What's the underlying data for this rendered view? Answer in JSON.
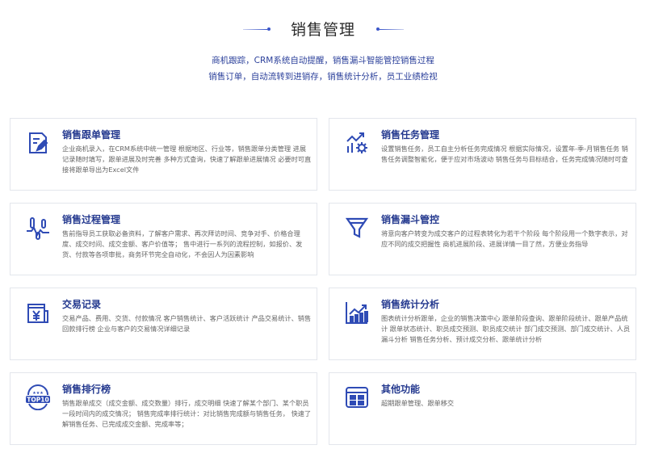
{
  "header": {
    "title": "销售管理",
    "subtitle_line1": "商机跟踪，CRM系统自动提醒，销售漏斗智能管控销售过程",
    "subtitle_line2": "销售订单，自动流转到进销存，销售统计分析，员工业绩检视"
  },
  "cards": [
    {
      "title": "销售跟单管理",
      "icon": "document-edit-icon",
      "desc": "企业商机录入，在CRM系统中统一管理 根据地区、行业等，销售跟单分类管理 进展记录随时填写，跟单进展及时完善 多种方式查询，快速了解跟单进展情况 必要时可直接将跟单导出为Excel文件"
    },
    {
      "title": "销售任务管理",
      "icon": "chart-gear-icon",
      "desc": "设置销售任务，员工自主分析任务完成情况 根据实际情况，设置年-季-月销售任务 销售任务调整智能化，便于应对市场波动 销售任务与目标结合，任务完成情况随时可查"
    },
    {
      "title": "销售过程管理",
      "icon": "process-pulse-icon",
      "desc": "售前指导员工获取必备资料，了解客户需求、再次拜访时间、竞争对手、价格合理度、成交时间、成交金额、客户价值等； 售中进行一系列的流程控制，如报价、发货、付款等各项审批，商务环节完全自动化，不会因人为因素影响"
    },
    {
      "title": "销售漏斗管控",
      "icon": "funnel-icon",
      "desc": "将意向客户转变为成交客户的过程表转化为若干个阶段 每个阶段用一个数字表示，对应不同的成交把握性 商机进展阶段、进展详情一目了然，方便业务指导"
    },
    {
      "title": "交易记录",
      "icon": "yuan-document-icon",
      "desc": "交易产品、费用、交货、付款情况 客户销售统计、客户活跃统计 产品交易统计、销售回款排行榜 企业与客户的交易情况详细记录"
    },
    {
      "title": "销售统计分析",
      "icon": "bar-chart-icon",
      "desc": "图表统计分析跟单，企业的销售决策中心 跟单阶段查询、跟单阶段统计、跟单产品统计 跟单状态统计、职员成交预测、职员成交统计 部门成交预测、部门成交统计、人员漏斗分析 销售任务分析、预计成交分析、跟单统计分析"
    },
    {
      "title": "销售排行榜",
      "icon": "top10-badge-icon",
      "desc": "销售跟单成交（成交金额、成交数量）排行，成交明细 快速了解某个部门、某个职员一段时间内的成交情况； 销售完成率排行统计：对比销售完成额与销售任务， 快速了解销售任务、已完成成交金额、完成率等；"
    },
    {
      "title": "其他功能",
      "icon": "app-grid-icon",
      "desc": "超期跟单管理、跟单移交"
    }
  ],
  "colors": {
    "accent": "#2a3f9a",
    "icon": "#2f4bb5",
    "border": "#e3e6ec"
  }
}
